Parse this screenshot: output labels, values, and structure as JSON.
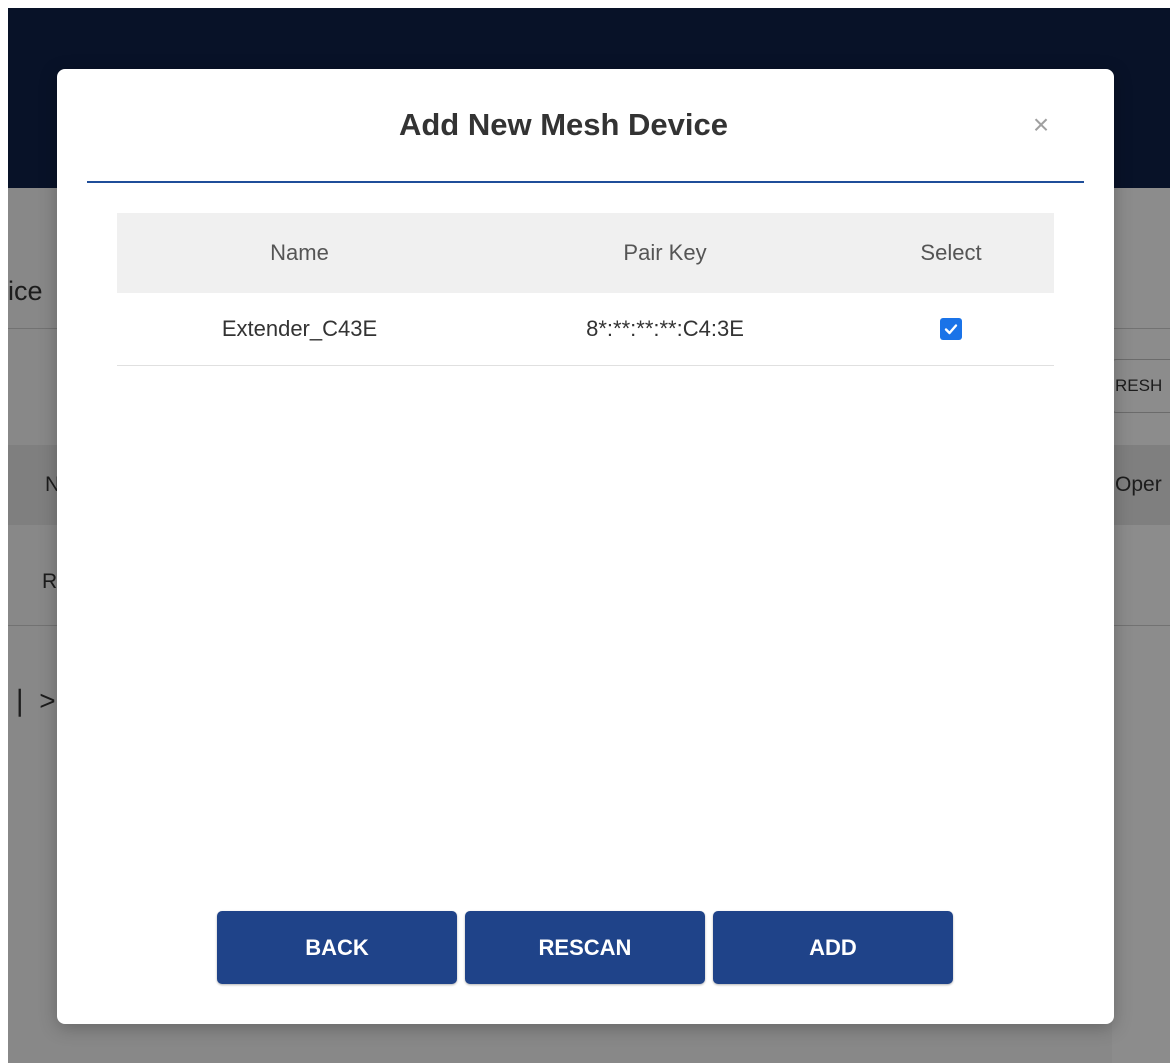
{
  "background": {
    "section_title_fragment": "ice",
    "refresh_fragment": "RESH",
    "col_fragment_left": "N",
    "col_fragment_right": "Oper",
    "row_fragment": "R",
    "breadcrumb_fragment": "❘ >"
  },
  "modal": {
    "title": "Add New Mesh Device",
    "close_symbol": "×",
    "table": {
      "headers": {
        "name": "Name",
        "pair_key": "Pair Key",
        "select": "Select"
      },
      "rows": [
        {
          "name": "Extender_C43E",
          "pair_key": "8*:**:**:**:C4:3E",
          "selected": true
        }
      ]
    },
    "buttons": {
      "back": "BACK",
      "rescan": "RESCAN",
      "add": "ADD"
    }
  },
  "colors": {
    "header_bg": "#0f2249",
    "accent": "#1f4389",
    "checkbox": "#1a73e8"
  }
}
